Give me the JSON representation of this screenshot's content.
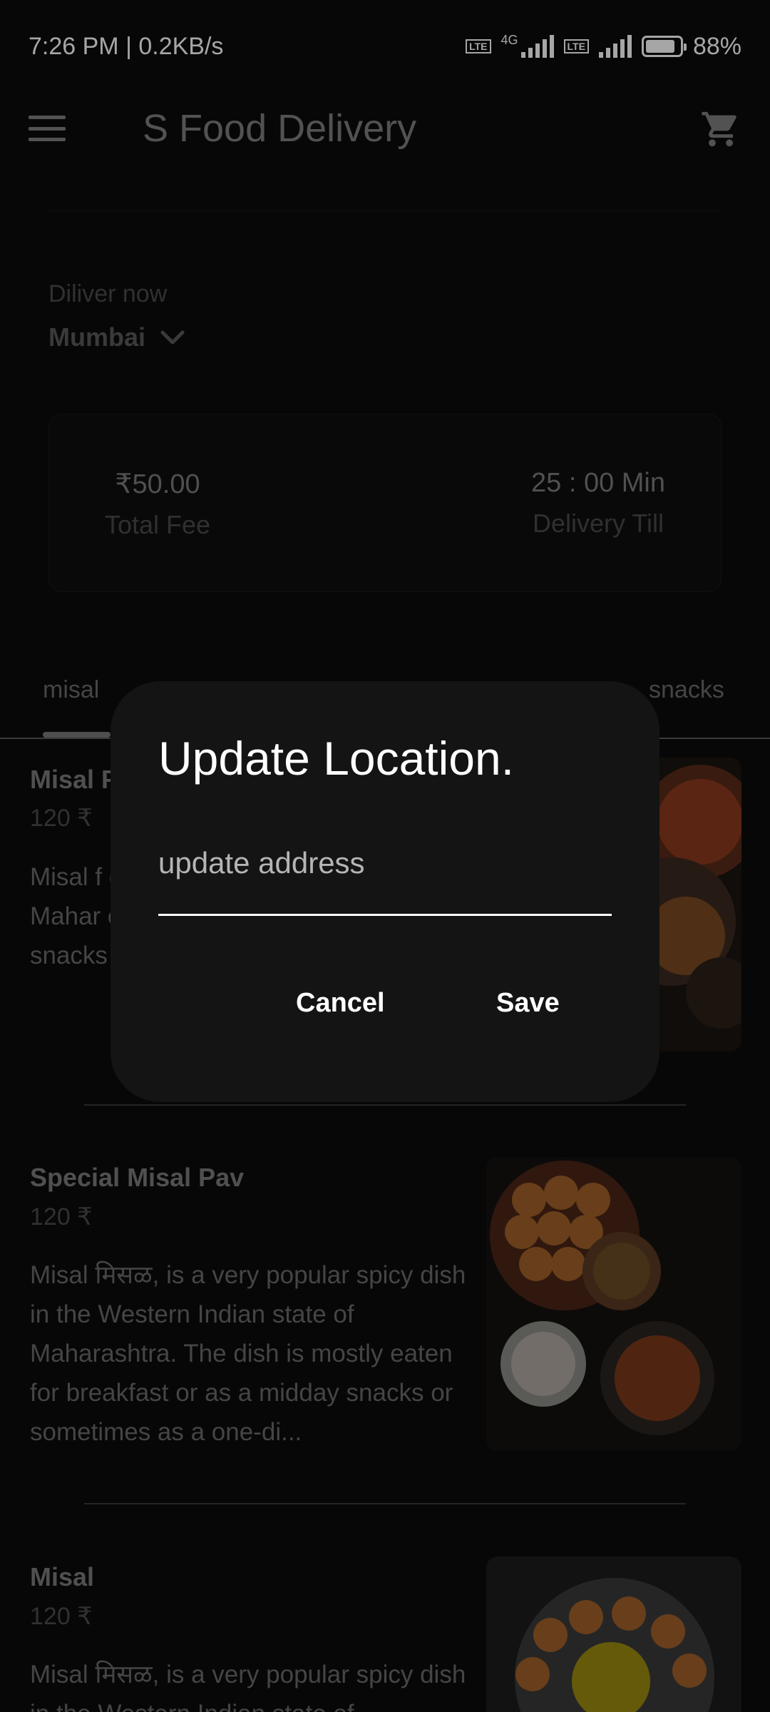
{
  "status_bar": {
    "time_speed": "7:26 PM | 0.2KB/s",
    "network_type": "4G",
    "lte_badge": "Vo LTE",
    "battery": "88%",
    "battery_level": 0.88
  },
  "app_bar": {
    "title": "S Food Delivery"
  },
  "location": {
    "deliver_label": "Diliver now",
    "city": "Mumbai"
  },
  "fee_card": {
    "total_fee_value": "₹50.00",
    "total_fee_label": "Total Fee",
    "delivery_value": "25 : 00 Min",
    "delivery_label": "Delivery Till"
  },
  "tabs": [
    {
      "label": "misal",
      "selected": true
    },
    {
      "label": "snacks",
      "selected": false
    }
  ],
  "items": [
    {
      "name": "Misal P",
      "price": "120 ₹",
      "description": "Misal f dish in Mahar eaten f snacks"
    },
    {
      "name": "Special Misal Pav",
      "price": "120 ₹",
      "description": "Misal मिसळ, is a very popular spicy dish in the Western Indian state of Maharashtra. The dish is mostly eaten for breakfast or as a midday snacks or sometimes as a one-di..."
    },
    {
      "name": "Misal",
      "price": "120 ₹",
      "description": "Misal मिसळ, is a very popular spicy dish in the Western Indian state of Maharashtra."
    }
  ],
  "dialog": {
    "title": "Update Location.",
    "input_placeholder": "update address",
    "input_value": "",
    "cancel_label": "Cancel",
    "save_label": "Save"
  },
  "icons": {
    "menu": "menu-icon",
    "cart": "cart-icon",
    "chevron": "chevron-down-icon"
  },
  "colors": {
    "background": "#0b0b0b",
    "dialog": "#141414",
    "text_primary": "#ffffff"
  }
}
